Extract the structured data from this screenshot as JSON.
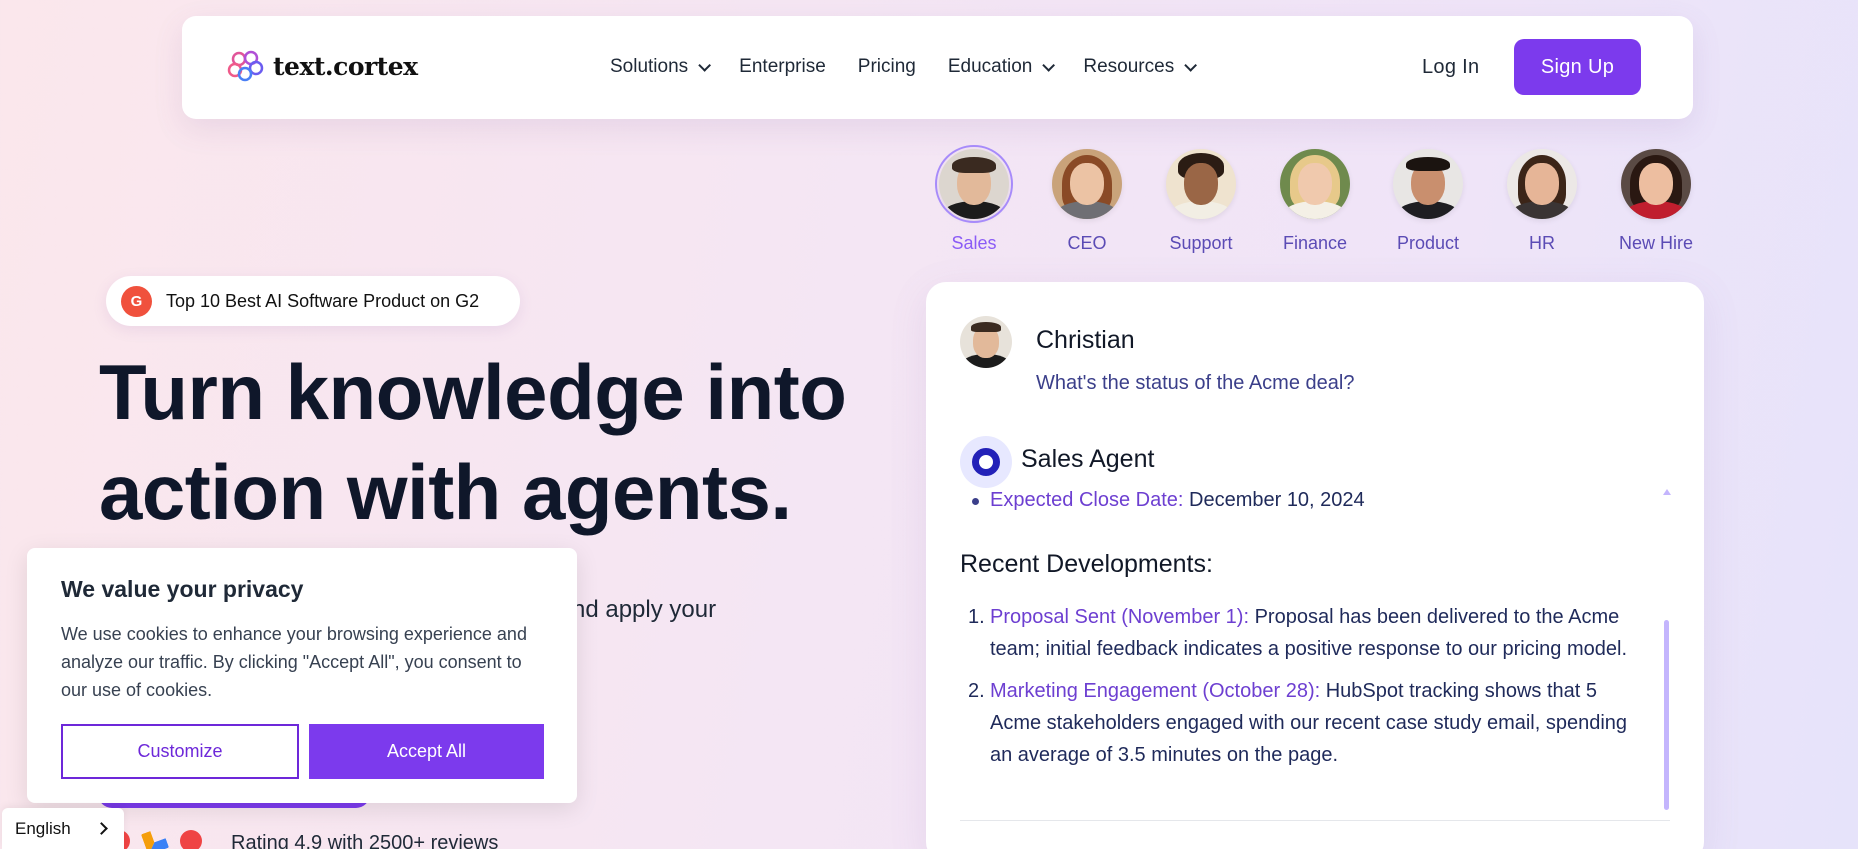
{
  "nav": {
    "logo_text": "text.cortex",
    "items": [
      {
        "label": "Solutions",
        "has_dropdown": true
      },
      {
        "label": "Enterprise",
        "has_dropdown": false
      },
      {
        "label": "Pricing",
        "has_dropdown": false
      },
      {
        "label": "Education",
        "has_dropdown": true
      },
      {
        "label": "Resources",
        "has_dropdown": true
      }
    ],
    "login_label": "Log In",
    "signup_label": "Sign Up"
  },
  "personas": [
    {
      "label": "Sales",
      "active": true
    },
    {
      "label": "CEO",
      "active": false
    },
    {
      "label": "Support",
      "active": false
    },
    {
      "label": "Finance",
      "active": false
    },
    {
      "label": "Product",
      "active": false
    },
    {
      "label": "HR",
      "active": false
    },
    {
      "label": "New Hire",
      "active": false
    }
  ],
  "hero": {
    "badge_icon": "G",
    "badge_text": "Top 10 Best AI Software Product on G2",
    "headline_line1": "Turn knowledge into",
    "headline_line2": "action with agents.",
    "subtext_fragment": "nd apply your",
    "rating_text": "Rating 4.9 with 2500+ reviews"
  },
  "cookie": {
    "title": "We value your privacy",
    "body": "We use cookies to enhance your browsing experience and analyze our traffic. By clicking \"Accept All\", you consent to our use of cookies.",
    "customize_label": "Customize",
    "accept_label": "Accept All"
  },
  "language": {
    "label": "English"
  },
  "chat": {
    "user_name": "Christian",
    "user_message": "What's the status of the Acme deal?",
    "agent_name": "Sales Agent",
    "bullet_label": "Expected Close Date:",
    "bullet_value": "December 10, 2024",
    "section_title": "Recent Developments:",
    "developments": [
      {
        "num": "1.",
        "label": "Proposal Sent (November 1):",
        "text": "Proposal has been delivered to the Acme team; initial feedback indicates a positive response to our pricing model."
      },
      {
        "num": "2.",
        "label": "Marketing Engagement (October 28):",
        "text": "HubSpot tracking shows that 5 Acme stakeholders engaged with our recent case study email, spending an average of 3.5 minutes on the page."
      }
    ]
  },
  "colors": {
    "accent": "#7c3aed",
    "persona_label": "#5b4bb5",
    "chat_text": "#1f2a5a"
  }
}
